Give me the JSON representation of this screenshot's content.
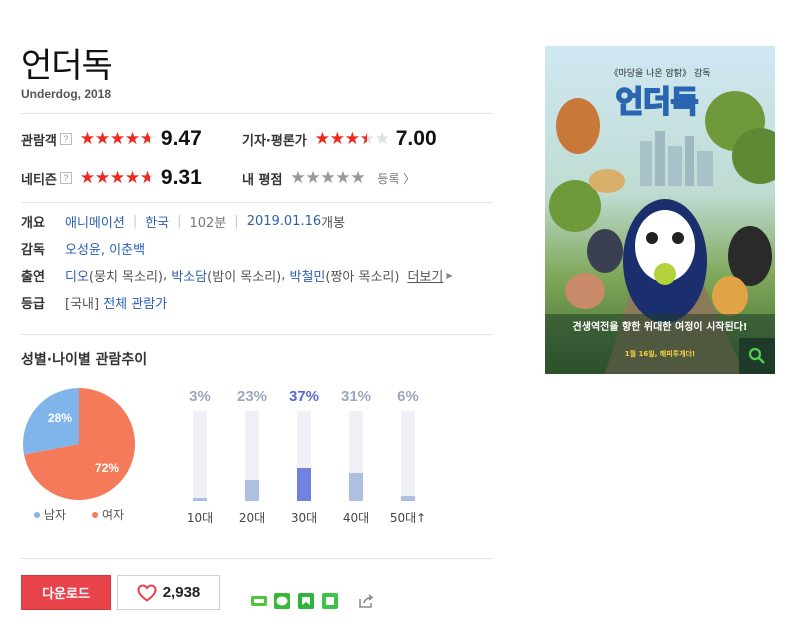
{
  "movie": {
    "title": "언더독",
    "subtitle": "Underdog, 2018"
  },
  "ratings": {
    "audience": {
      "label": "관람객",
      "help": "?",
      "score": "9.47",
      "stars": 4.7,
      "star_color": "#f0291f"
    },
    "critics": {
      "label": "기자·평론가",
      "score": "7.00",
      "stars": 3.5,
      "star_color": "#f0291f"
    },
    "netizen": {
      "label": "네티즌",
      "help": "?",
      "score": "9.31",
      "stars": 4.65,
      "star_color": "#f0291f"
    },
    "mine": {
      "label": "내 평점",
      "stars": 5,
      "star_color": "#9a9a9a",
      "register_label": "등록 〉"
    }
  },
  "info": {
    "overview": {
      "label": "개요",
      "genre": "애니메이션",
      "country": "한국",
      "runtime": "102분",
      "release_date": "2019.01.16",
      "release_suffix": "개봉"
    },
    "director": {
      "label": "감독",
      "value": "오성윤, 이춘백"
    },
    "cast": {
      "label": "출연",
      "entries": [
        {
          "name": "디오",
          "role": "(뭉치 목소리)"
        },
        {
          "name": "박소담",
          "role": "(밤이 목소리)"
        },
        {
          "name": "박철민",
          "role": "(짱아 목소리)"
        }
      ],
      "more_label": "더보기"
    },
    "grade": {
      "label": "등급",
      "region": "[국내]",
      "value": "전체 관람가"
    }
  },
  "trend": {
    "title": "성별·나이별 관람추이",
    "gender": {
      "male": {
        "label": "남자",
        "percent": 28,
        "display": "28%",
        "color": "#7fb5ea"
      },
      "female": {
        "label": "여자",
        "percent": 72,
        "display": "72%",
        "color": "#f47a5a"
      }
    },
    "ages": [
      {
        "label": "10대",
        "percent": 3,
        "display": "3%",
        "highlight": false
      },
      {
        "label": "20대",
        "percent": 23,
        "display": "23%",
        "highlight": false
      },
      {
        "label": "30대",
        "percent": 37,
        "display": "37%",
        "highlight": true
      },
      {
        "label": "40대",
        "percent": 31,
        "display": "31%",
        "highlight": false
      },
      {
        "label": "50대↑",
        "percent": 6,
        "display": "6%",
        "highlight": false
      }
    ],
    "colors": {
      "bar": "#aebfe0",
      "bar_highlight": "#7081e0",
      "pct": "#9aa7bf",
      "pct_highlight": "#5968d8"
    }
  },
  "poster": {
    "top_caption": "《마당을 나온 암탉》 감독",
    "title": "언더독",
    "tagline": "견생역전을 향한 위대한 여정이 시작된다!",
    "release_caption": "1월 16일, 해피투개더!",
    "zoom_icon": "magnifier-icon"
  },
  "actions": {
    "download_label": "다운로드",
    "like_count": "2,938",
    "share_icons": [
      "naver-band-icon",
      "line-icon",
      "naver-blog-icon",
      "naver-cafe-icon",
      "share-icon"
    ]
  }
}
